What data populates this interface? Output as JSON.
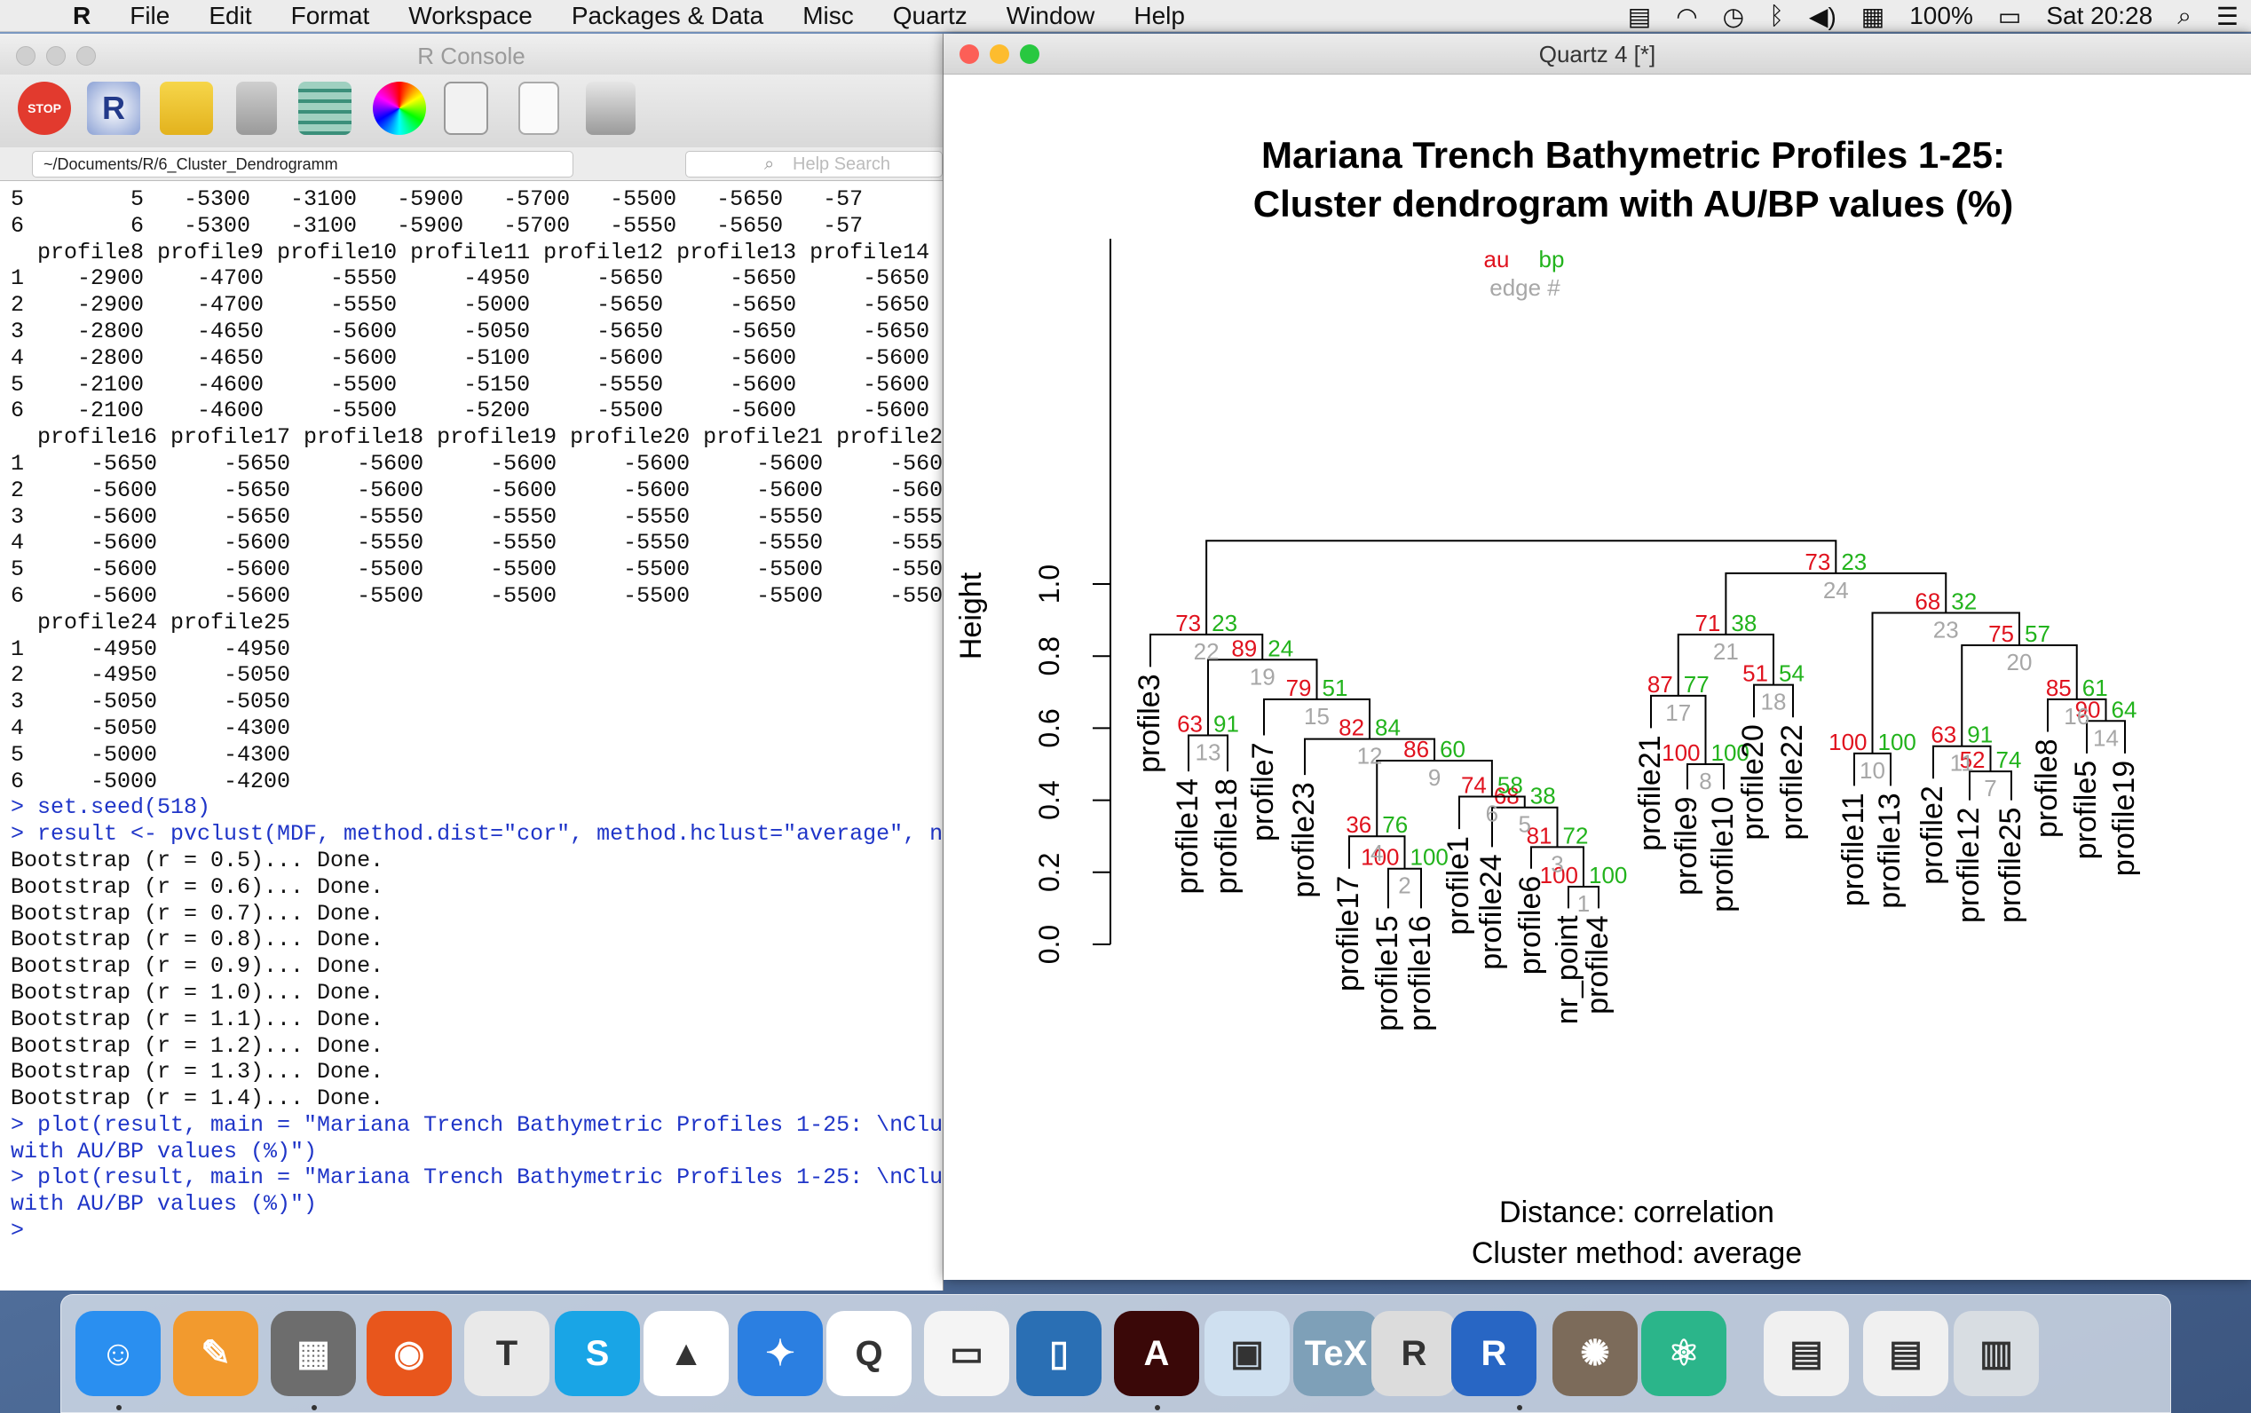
{
  "menubar": {
    "apple": "",
    "items": [
      "R",
      "File",
      "Edit",
      "Format",
      "Workspace",
      "Packages & Data",
      "Misc",
      "Quartz",
      "Window",
      "Help"
    ],
    "battery": "100%",
    "clock": "Sat 20:28"
  },
  "console": {
    "title": "R Console",
    "path": "~/Documents/R/6_Cluster_Dendrogramm",
    "help_placeholder": "Help Search",
    "toolbar": [
      "stop-icon",
      "r-logo-icon",
      "chart-icon",
      "lock-icon",
      "table-icon",
      "color-wheel-icon",
      "search-doc-icon",
      "new-doc-icon",
      "print-icon"
    ],
    "lines": [
      {
        "t": "5        5   -5300   -3100   -5900   -5700   -5500   -5650   -57",
        "c": "o"
      },
      {
        "t": "6        6   -5300   -3100   -5900   -5700   -5550   -5650   -57",
        "c": "o"
      },
      {
        "t": "  profile8 profile9 profile10 profile11 profile12 profile13 profile14 p",
        "c": "o"
      },
      {
        "t": "1    -2900    -4700     -5550     -4950     -5650     -5650     -5650",
        "c": "o"
      },
      {
        "t": "2    -2900    -4700     -5550     -5000     -5650     -5650     -5650",
        "c": "o"
      },
      {
        "t": "3    -2800    -4650     -5600     -5050     -5650     -5650     -5650",
        "c": "o"
      },
      {
        "t": "4    -2800    -4650     -5600     -5100     -5600     -5600     -5600",
        "c": "o"
      },
      {
        "t": "5    -2100    -4600     -5500     -5150     -5550     -5600     -5600",
        "c": "o"
      },
      {
        "t": "6    -2100    -4600     -5500     -5200     -5500     -5600     -5600",
        "c": "o"
      },
      {
        "t": "  profile16 profile17 profile18 profile19 profile20 profile21 profile22",
        "c": "o"
      },
      {
        "t": "1     -5650     -5650     -5600     -5600     -5600     -5600     -5600",
        "c": "o"
      },
      {
        "t": "2     -5600     -5650     -5600     -5600     -5600     -5600     -5600",
        "c": "o"
      },
      {
        "t": "3     -5600     -5650     -5550     -5550     -5550     -5550     -5550",
        "c": "o"
      },
      {
        "t": "4     -5600     -5600     -5550     -5550     -5550     -5550     -5550",
        "c": "o"
      },
      {
        "t": "5     -5600     -5600     -5500     -5500     -5500     -5500     -5500",
        "c": "o"
      },
      {
        "t": "6     -5600     -5600     -5500     -5500     -5500     -5500     -5500",
        "c": "o"
      },
      {
        "t": "  profile24 profile25",
        "c": "o"
      },
      {
        "t": "1     -4950     -4950",
        "c": "o"
      },
      {
        "t": "2     -4950     -5050",
        "c": "o"
      },
      {
        "t": "3     -5050     -5050",
        "c": "o"
      },
      {
        "t": "4     -5050     -4300",
        "c": "o"
      },
      {
        "t": "5     -5000     -4300",
        "c": "o"
      },
      {
        "t": "6     -5000     -4200",
        "c": "o"
      },
      {
        "t": "> set.seed(518)",
        "c": "c"
      },
      {
        "t": "> result <- pvclust(MDF, method.dist=\"cor\", method.hclust=\"average\", nb",
        "c": "c"
      },
      {
        "t": "Bootstrap (r = 0.5)... Done.",
        "c": "o"
      },
      {
        "t": "Bootstrap (r = 0.6)... Done.",
        "c": "o"
      },
      {
        "t": "Bootstrap (r = 0.7)... Done.",
        "c": "o"
      },
      {
        "t": "Bootstrap (r = 0.8)... Done.",
        "c": "o"
      },
      {
        "t": "Bootstrap (r = 0.9)... Done.",
        "c": "o"
      },
      {
        "t": "Bootstrap (r = 1.0)... Done.",
        "c": "o"
      },
      {
        "t": "Bootstrap (r = 1.1)... Done.",
        "c": "o"
      },
      {
        "t": "Bootstrap (r = 1.2)... Done.",
        "c": "o"
      },
      {
        "t": "Bootstrap (r = 1.3)... Done.",
        "c": "o"
      },
      {
        "t": "Bootstrap (r = 1.4)... Done.",
        "c": "o"
      },
      {
        "t": "> plot(result, main = \"Mariana Trench Bathymetric Profiles 1-25: \\nClus",
        "c": "c"
      },
      {
        "t": "with AU/BP values (%)\")",
        "c": "c"
      },
      {
        "t": "> plot(result, main = \"Mariana Trench Bathymetric Profiles 1-25: \\nClus",
        "c": "c"
      },
      {
        "t": "with AU/BP values (%)\")",
        "c": "c"
      },
      {
        "t": ">",
        "c": "c"
      }
    ]
  },
  "quartz": {
    "title": "Quartz 4 [*]"
  },
  "chart_data": {
    "type": "dendrogram",
    "title": "Mariana Trench Bathymetric Profiles 1-25:",
    "subtitle": "Cluster dendrogram with AU/BP values (%)",
    "ylabel": "Height",
    "ylim": [
      0,
      1.0
    ],
    "yticks": [
      "0.0",
      "0.2",
      "0.4",
      "0.6",
      "0.8",
      "1.0"
    ],
    "footer_1": "Distance:  correlation",
    "footer_2": "Cluster method: average",
    "legend": {
      "au": "au",
      "bp": "bp",
      "edge": "edge #"
    },
    "leaves": [
      "profile3",
      "profile14",
      "profile18",
      "profile7",
      "profile23",
      "profile17",
      "profile15",
      "profile16",
      "profile1",
      "profile24",
      "profile6",
      "nr_point",
      "profile4",
      "profile21",
      "profile9",
      "profile10",
      "profile20",
      "profile22",
      "profile11",
      "profile13",
      "profile2",
      "profile12",
      "profile25",
      "profile8",
      "profile5",
      "profile19"
    ],
    "nodes": [
      {
        "edge": "1",
        "height": 0.16,
        "au": "100",
        "bp": "100"
      },
      {
        "edge": "2",
        "height": 0.21,
        "au": "100",
        "bp": "100"
      },
      {
        "edge": "3",
        "height": 0.27,
        "au": "81",
        "bp": "72"
      },
      {
        "edge": "4",
        "height": 0.3,
        "au": "36",
        "bp": "76"
      },
      {
        "edge": "5",
        "height": 0.38,
        "au": "68",
        "bp": "38"
      },
      {
        "edge": "6",
        "height": 0.41,
        "au": "74",
        "bp": "58"
      },
      {
        "edge": "7",
        "height": 0.48,
        "au": "52",
        "bp": "74"
      },
      {
        "edge": "8",
        "height": 0.5,
        "au": "100",
        "bp": "100"
      },
      {
        "edge": "9",
        "height": 0.51,
        "au": "86",
        "bp": "60"
      },
      {
        "edge": "10",
        "height": 0.53,
        "au": "100",
        "bp": "100"
      },
      {
        "edge": "11",
        "height": 0.55,
        "au": "63",
        "bp": "91"
      },
      {
        "edge": "12",
        "height": 0.57,
        "au": "82",
        "bp": "84"
      },
      {
        "edge": "13",
        "height": 0.58,
        "au": "63",
        "bp": "91"
      },
      {
        "edge": "14",
        "height": 0.62,
        "au": "90",
        "bp": "64"
      },
      {
        "edge": "15",
        "height": 0.68,
        "au": "79",
        "bp": "51"
      },
      {
        "edge": "16",
        "height": 0.68,
        "au": "85",
        "bp": "61"
      },
      {
        "edge": "17",
        "height": 0.69,
        "au": "87",
        "bp": "77"
      },
      {
        "edge": "18",
        "height": 0.72,
        "au": "51",
        "bp": "54"
      },
      {
        "edge": "19",
        "height": 0.79,
        "au": "89",
        "bp": "24"
      },
      {
        "edge": "20",
        "height": 0.83,
        "au": "75",
        "bp": "57"
      },
      {
        "edge": "21",
        "height": 0.86,
        "au": "71",
        "bp": "38"
      },
      {
        "edge": "22",
        "height": 0.86,
        "au": "73",
        "bp": "23"
      },
      {
        "edge": "23",
        "height": 0.92,
        "au": "68",
        "bp": "32"
      },
      {
        "edge": "24",
        "height": 1.03,
        "au": "73",
        "bp": "23"
      },
      {
        "edge": "",
        "height": 1.12,
        "au": "",
        "bp": ""
      }
    ]
  },
  "dock": {
    "apps": [
      "finder",
      "pages",
      "calculator",
      "firefox",
      "textedit",
      "skype",
      "vlc",
      "safari",
      "qgis",
      "preview-doc",
      "books",
      "acrobat",
      "image-capture",
      "tex",
      "r-old",
      "r",
      "gimp",
      "atom",
      "minimized-1",
      "minimized-2",
      "trash"
    ]
  }
}
